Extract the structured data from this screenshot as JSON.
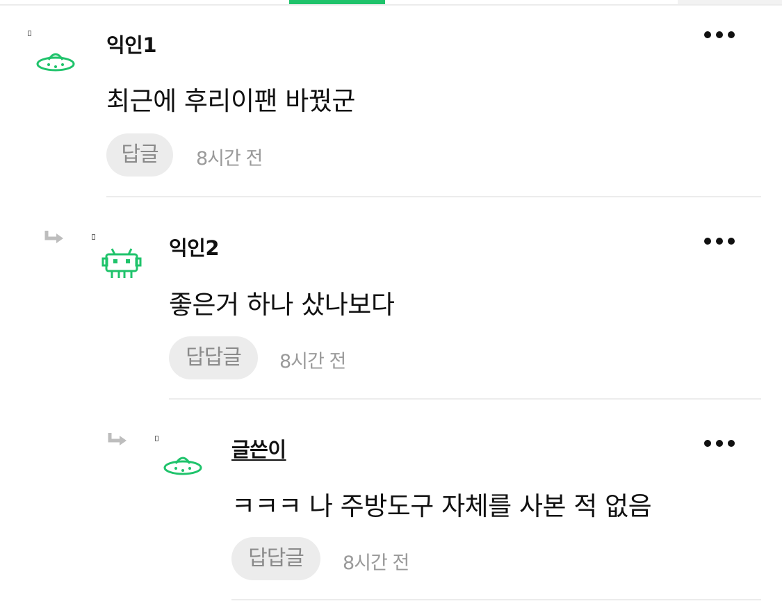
{
  "colors": {
    "accent": "#1fc36b",
    "divider": "#ececec",
    "button_bg": "#ececec",
    "muted_text": "#9a9a9a"
  },
  "comments": [
    {
      "author": "익인1",
      "avatar_icon": "ufo-icon",
      "text": "최근에 후리이팬 바꿨군",
      "reply_label": "답글",
      "time": "8시간 전"
    },
    {
      "author": "익인2",
      "avatar_icon": "space-invader-icon",
      "text": "좋은거 하나 샀나보다",
      "reply_label": "답답글",
      "time": "8시간 전"
    },
    {
      "author": "글쓴이",
      "avatar_icon": "ufo-icon",
      "text": "ㅋㅋㅋ 나 주방도구 자체를 사본 적 없음",
      "reply_label": "답답글",
      "time": "8시간 전"
    }
  ]
}
